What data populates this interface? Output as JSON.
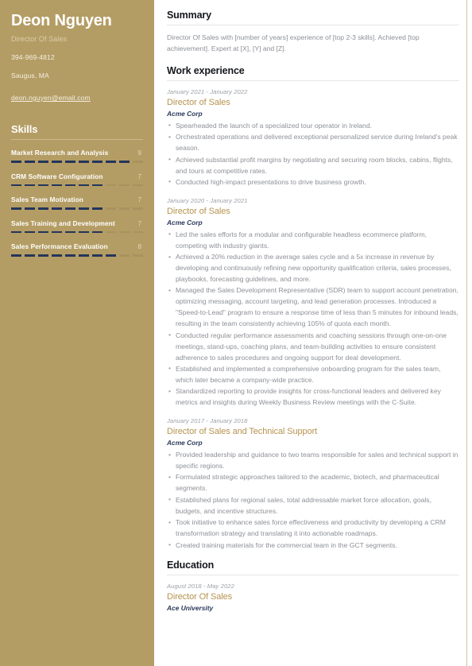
{
  "theme": {
    "sidebar_bg": "#b49d64",
    "accent_gold": "#b5934f",
    "org_navy": "#2b3a5c",
    "body_text": "#8c9096"
  },
  "sidebar": {
    "name": "Deon Nguyen",
    "role": "Director Of Sales",
    "contacts": [
      {
        "icon": "phone-icon",
        "value": "394-969-4812",
        "is_link": false
      },
      {
        "icon": "location-icon",
        "value": "Saugus, MA",
        "is_link": false
      },
      {
        "icon": "email-icon",
        "value": "deon.nguyen@email.com",
        "is_link": true
      }
    ],
    "skills_heading": "Skills",
    "skills_max": 10,
    "skills": [
      {
        "label": "Market Research and Analysis",
        "score": 9
      },
      {
        "label": "CRM Software Configuration",
        "score": 7
      },
      {
        "label": "Sales Team Motivation",
        "score": 7
      },
      {
        "label": "Sales Training and Development",
        "score": 7
      },
      {
        "label": "Sales Performance Evaluation",
        "score": 8
      }
    ]
  },
  "main": {
    "summary": {
      "heading": "Summary",
      "text": "Director Of Sales with [number of years] experience of [top 2-3 skills]. Achieved [top achievement]. Expert at [X], [Y] and [Z]."
    },
    "work": {
      "heading": "Work experience",
      "entries": [
        {
          "dates": "January 2021 - January 2022",
          "title": "Director of Sales",
          "org": "Acme Corp",
          "bullets": [
            "Spearheaded the launch of a specialized tour operator in Ireland.",
            "Orchestrated operations and delivered exceptional personalized service during Ireland's peak season.",
            "Achieved substantial profit margins by negotiating and securing room blocks, cabins, flights, and tours at competitive rates.",
            "Conducted high-impact presentations to drive business growth."
          ]
        },
        {
          "dates": "January 2020 - January 2021",
          "title": "Director of Sales",
          "org": "Acme Corp",
          "bullets": [
            "Led the sales efforts for a modular and configurable headless ecommerce platform, competing with industry giants.",
            "Achieved a 20% reduction in the average sales cycle and a 5x increase in revenue by developing and continuously refining new opportunity qualification criteria, sales processes, playbooks, forecasting guidelines, and more.",
            "Managed the Sales Development Representative (SDR) team to support account penetration, optimizing messaging, account targeting, and lead generation processes. Introduced a \"Speed-to-Lead\" program to ensure a response time of less than 5 minutes for inbound leads, resulting in the team consistently achieving 105% of quota each month.",
            "Conducted regular performance assessments and coaching sessions through one-on-one meetings, stand-ups, coaching plans, and team-building activities to ensure consistent adherence to sales procedures and ongoing support for deal development.",
            "Established and implemented a comprehensive onboarding program for the sales team, which later became a company-wide practice.",
            "Standardized reporting to provide insights for cross-functional leaders and delivered key metrics and insights during Weekly Business Review meetings with the C-Suite."
          ]
        },
        {
          "dates": "January 2017 - January 2018",
          "title": "Director of Sales and Technical Support",
          "org": "Acme Corp",
          "bullets": [
            "Provided leadership and guidance to two teams responsible for sales and technical support in specific regions.",
            "Formulated strategic approaches tailored to the academic, biotech, and pharmaceutical segments.",
            "Established plans for regional sales, total addressable market force allocation, goals, budgets, and incentive structures.",
            "Took initiative to enhance sales force effectiveness and productivity by developing a CRM transformation strategy and translating it into actionable roadmaps.",
            "Created training materials for the commercial team in the GCT segments."
          ]
        }
      ]
    },
    "education": {
      "heading": "Education",
      "entries": [
        {
          "dates": "August 2018 - May 2022",
          "title": "Director Of Sales",
          "org": "Ace University"
        }
      ]
    }
  }
}
